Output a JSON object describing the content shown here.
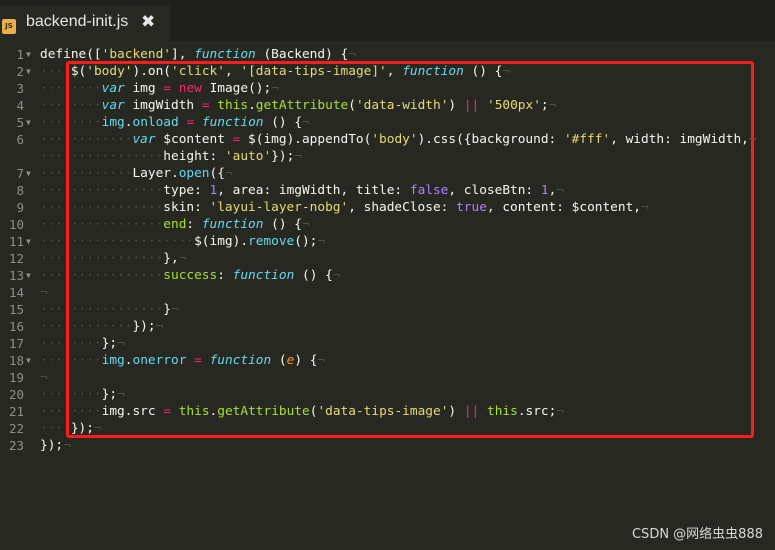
{
  "tab": {
    "icon_label": "JS",
    "title": "backend-init.js",
    "close_glyph": "✖"
  },
  "line_numbers": [
    "1",
    "2",
    "3",
    "4",
    "5",
    "6",
    "7",
    "8",
    "9",
    "10",
    "11",
    "12",
    "13",
    "14",
    "15",
    "16",
    "17",
    "18",
    "19",
    "20",
    "21",
    "22",
    "23"
  ],
  "fold_markers": {
    "lines_with_marker": [
      "1",
      "2",
      "5",
      "7",
      "11",
      "13",
      "18"
    ]
  },
  "code_lines": [
    {
      "num": "1",
      "indent": 0,
      "tokens": [
        [
          "p",
          "define(["
        ],
        [
          "s",
          "'backend'"
        ],
        [
          "p",
          "], "
        ],
        [
          "k",
          "function"
        ],
        [
          "p",
          " (Backend) {"
        ]
      ]
    },
    {
      "num": "2",
      "indent": 4,
      "tokens": [
        [
          "p",
          "$("
        ],
        [
          "s",
          "'body'"
        ],
        [
          "p",
          ").on("
        ],
        [
          "s",
          "'click'"
        ],
        [
          "p",
          ", "
        ],
        [
          "s",
          "'[data-tips-image]'"
        ],
        [
          "p",
          ", "
        ],
        [
          "k",
          "function"
        ],
        [
          "p",
          " () {"
        ]
      ]
    },
    {
      "num": "3",
      "indent": 8,
      "tokens": [
        [
          "k",
          "var"
        ],
        [
          "p",
          " img "
        ],
        [
          "o",
          "="
        ],
        [
          "p",
          " "
        ],
        [
          "o",
          "new"
        ],
        [
          "p",
          " Image();"
        ]
      ]
    },
    {
      "num": "4",
      "indent": 8,
      "tokens": [
        [
          "k",
          "var"
        ],
        [
          "p",
          " imgWidth "
        ],
        [
          "o",
          "="
        ],
        [
          "p",
          " "
        ],
        [
          "f",
          "this"
        ],
        [
          "p",
          "."
        ],
        [
          "f",
          "getAttribute"
        ],
        [
          "p",
          "("
        ],
        [
          "s",
          "'data-width'"
        ],
        [
          "p",
          ") "
        ],
        [
          "o",
          "||"
        ],
        [
          "p",
          " "
        ],
        [
          "s",
          "'500px'"
        ],
        [
          "p",
          ";"
        ]
      ]
    },
    {
      "num": "5",
      "indent": 8,
      "tokens": [
        [
          "r",
          "img"
        ],
        [
          "p",
          "."
        ],
        [
          "r",
          "onload"
        ],
        [
          "p",
          " "
        ],
        [
          "o",
          "="
        ],
        [
          "p",
          " "
        ],
        [
          "k",
          "function"
        ],
        [
          "p",
          " () {"
        ]
      ]
    },
    {
      "num": "6",
      "indent": 12,
      "tokens": [
        [
          "k",
          "var"
        ],
        [
          "p",
          " $content "
        ],
        [
          "o",
          "="
        ],
        [
          "p",
          " $(img).appendTo("
        ],
        [
          "s",
          "'body'"
        ],
        [
          "p",
          ").css({background: "
        ],
        [
          "s",
          "'#fff'"
        ],
        [
          "p",
          ", width: imgWidth,"
        ]
      ]
    },
    {
      "num": "",
      "indent": 16,
      "tokens": [
        [
          "p",
          "height: "
        ],
        [
          "s",
          "'auto'"
        ],
        [
          "p",
          "});"
        ]
      ]
    },
    {
      "num": "7",
      "indent": 12,
      "tokens": [
        [
          "p",
          "Layer."
        ],
        [
          "r",
          "open"
        ],
        [
          "p",
          "({"
        ]
      ]
    },
    {
      "num": "8",
      "indent": 16,
      "tokens": [
        [
          "p",
          "type: "
        ],
        [
          "n",
          "1"
        ],
        [
          "p",
          ", area: imgWidth, title: "
        ],
        [
          "n",
          "false"
        ],
        [
          "p",
          ", closeBtn: "
        ],
        [
          "n",
          "1"
        ],
        [
          "p",
          ","
        ]
      ]
    },
    {
      "num": "9",
      "indent": 16,
      "tokens": [
        [
          "p",
          "skin: "
        ],
        [
          "s",
          "'layui-layer-nobg'"
        ],
        [
          "p",
          ", shadeClose: "
        ],
        [
          "n",
          "true"
        ],
        [
          "p",
          ", content: $content,"
        ]
      ]
    },
    {
      "num": "10",
      "indent": 16,
      "tokens": [
        [
          "f",
          "end"
        ],
        [
          "p",
          ": "
        ],
        [
          "k",
          "function"
        ],
        [
          "p",
          " () {"
        ]
      ]
    },
    {
      "num": "11",
      "indent": 20,
      "tokens": [
        [
          "p",
          "$(img)."
        ],
        [
          "r",
          "remove"
        ],
        [
          "p",
          "();"
        ]
      ]
    },
    {
      "num": "12",
      "indent": 16,
      "tokens": [
        [
          "p",
          "},"
        ]
      ]
    },
    {
      "num": "13",
      "indent": 16,
      "tokens": [
        [
          "f",
          "success"
        ],
        [
          "p",
          ": "
        ],
        [
          "k",
          "function"
        ],
        [
          "p",
          " () {"
        ]
      ]
    },
    {
      "num": "14",
      "indent": 0,
      "tokens": []
    },
    {
      "num": "15",
      "indent": 16,
      "tokens": [
        [
          "p",
          "}"
        ]
      ]
    },
    {
      "num": "16",
      "indent": 12,
      "tokens": [
        [
          "p",
          "});"
        ]
      ]
    },
    {
      "num": "17",
      "indent": 8,
      "tokens": [
        [
          "p",
          "};"
        ]
      ]
    },
    {
      "num": "18",
      "indent": 8,
      "tokens": [
        [
          "r",
          "img"
        ],
        [
          "p",
          "."
        ],
        [
          "r",
          "onerror"
        ],
        [
          "p",
          " "
        ],
        [
          "o",
          "="
        ],
        [
          "p",
          " "
        ],
        [
          "k",
          "function"
        ],
        [
          "p",
          " ("
        ],
        [
          "a",
          "e"
        ],
        [
          "p",
          ") {"
        ]
      ]
    },
    {
      "num": "19",
      "indent": 0,
      "tokens": []
    },
    {
      "num": "20",
      "indent": 8,
      "tokens": [
        [
          "p",
          "};"
        ]
      ]
    },
    {
      "num": "21",
      "indent": 8,
      "tokens": [
        [
          "p",
          "img.src "
        ],
        [
          "o",
          "="
        ],
        [
          "p",
          " "
        ],
        [
          "f",
          "this"
        ],
        [
          "p",
          "."
        ],
        [
          "f",
          "getAttribute"
        ],
        [
          "p",
          "("
        ],
        [
          "s",
          "'data-tips-image'"
        ],
        [
          "p",
          ") "
        ],
        [
          "o",
          "||"
        ],
        [
          "p",
          " "
        ],
        [
          "f",
          "this"
        ],
        [
          "p",
          ".src;"
        ]
      ]
    },
    {
      "num": "22",
      "indent": 4,
      "tokens": [
        [
          "p",
          "});"
        ]
      ]
    },
    {
      "num": "23",
      "indent": 0,
      "tokens": [
        [
          "p",
          "});"
        ]
      ]
    }
  ],
  "watermark": "CSDN @网络虫虫888",
  "colors": {
    "background": "#272822",
    "tab_bar": "#1f201c",
    "highlight_box": "#ff1c1c",
    "string": "#e6db74",
    "keyword": "#66d9ef",
    "operator": "#f92672",
    "constant": "#ae81ff",
    "function": "#a6e22e",
    "parameter": "#fd971f"
  }
}
